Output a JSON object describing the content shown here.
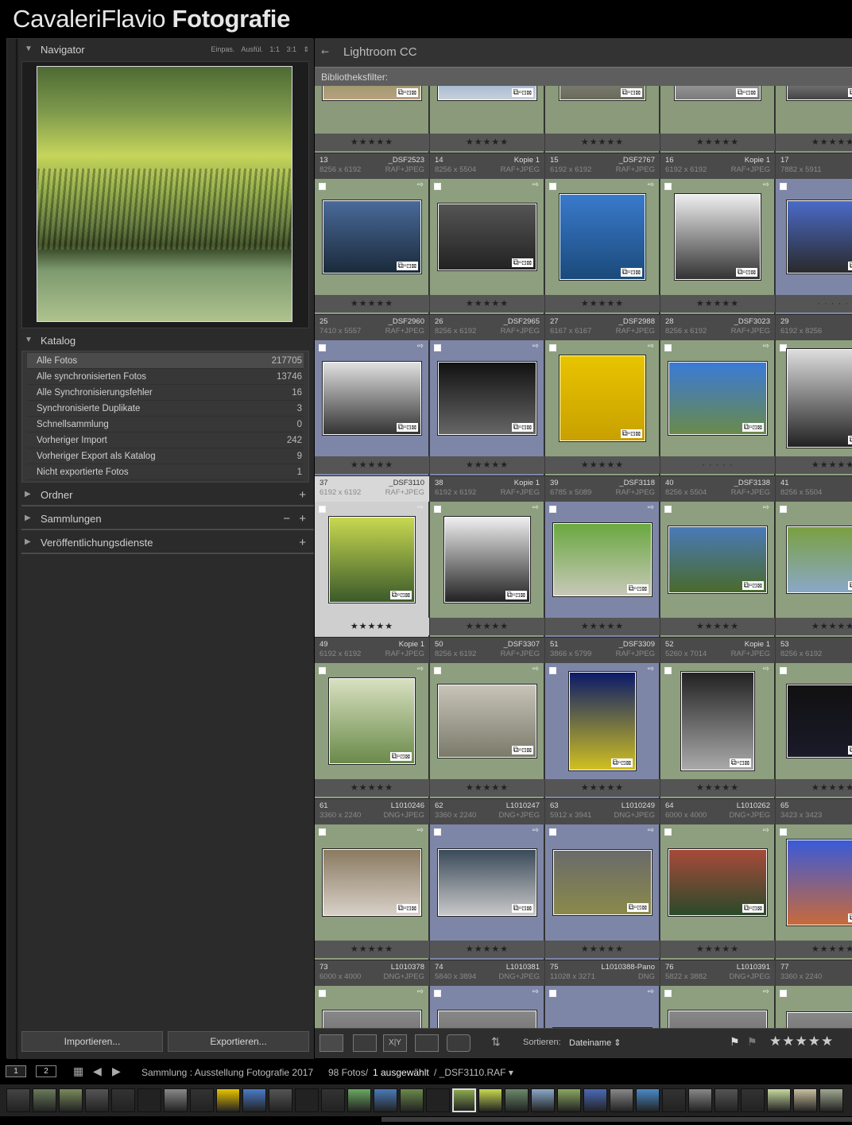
{
  "brand": {
    "first": "CavaleriFlavio ",
    "bold": "Fotografie"
  },
  "navigator": {
    "title": "Navigator",
    "options": "Einpas.  Ausfül.  1:1  3:1  ⇕"
  },
  "katalog": {
    "title": "Katalog",
    "items": [
      {
        "label": "Alle Fotos",
        "count": "217705",
        "selected": true
      },
      {
        "label": "Alle synchronisierten Fotos",
        "count": "13746"
      },
      {
        "label": "Alle Synchronisierungsfehler",
        "count": "16"
      },
      {
        "label": "Synchronisierte Duplikate",
        "count": "3"
      },
      {
        "label": "Schnellsammlung",
        "count": "0"
      },
      {
        "label": "Vorheriger Import",
        "count": "242"
      },
      {
        "label": "Vorheriger Export als Katalog",
        "count": "9"
      },
      {
        "label": "Nicht exportierte Fotos",
        "count": "1"
      }
    ]
  },
  "panels": {
    "ordner": "Ordner",
    "sammlungen": "Sammlungen",
    "veroeffentlichung": "Veröffentlichungsdienste"
  },
  "buttons": {
    "import": "Importieren...",
    "export": "Exportieren..."
  },
  "header": {
    "title": "Lightroom CC",
    "filter": "Bibliotheksfilter:"
  },
  "toolbar": {
    "sort_label": "Sortieren:",
    "sort_value": "Dateiname ⇕",
    "stars": "★★★★★"
  },
  "bottom": {
    "page1": "1",
    "page2": "2",
    "path": "Sammlung : Ausstellung Fotografie 2017",
    "count": "98 Fotos/",
    "selected": "1 ausgewählt",
    "file": "/ _DSF3110.RAF ▾"
  },
  "grid": {
    "stars": "★★★★★",
    "dots": "· · · · ·",
    "rows": [
      {
        "cells": [
          {
            "num": "",
            "name": "",
            "dim": "",
            "fmt": ""
          },
          {
            "num": "",
            "name": "",
            "dim": "",
            "fmt": ""
          },
          {
            "num": "",
            "name": "",
            "dim": "",
            "fmt": ""
          },
          {
            "num": "",
            "name": "",
            "dim": "",
            "fmt": ""
          },
          {
            "num": "",
            "name": "",
            "dim": "",
            "fmt": ""
          }
        ]
      },
      {
        "cells": [
          {
            "num": "13",
            "name": "_DSF2523",
            "dim": "8256 x 6192",
            "fmt": "RAF+JPEG"
          },
          {
            "num": "14",
            "name": "Kopie 1",
            "dim": "8256 x 5504",
            "fmt": "RAF+JPEG"
          },
          {
            "num": "15",
            "name": "_DSF2767",
            "dim": "6192 x 6192",
            "fmt": "RAF+JPEG"
          },
          {
            "num": "16",
            "name": "Kopie 1",
            "dim": "6192 x 6192",
            "fmt": "RAF+JPEG"
          },
          {
            "num": "17",
            "name": "",
            "dim": "7882 x 5911",
            "fmt": ""
          }
        ]
      },
      {
        "cells": [
          {
            "num": "25",
            "name": "_DSF2960",
            "dim": "7410 x 5557",
            "fmt": "RAF+JPEG"
          },
          {
            "num": "26",
            "name": "_DSF2965",
            "dim": "8256 x 6192",
            "fmt": "RAF+JPEG"
          },
          {
            "num": "27",
            "name": "_DSF2988",
            "dim": "6167 x 6167",
            "fmt": "RAF+JPEG"
          },
          {
            "num": "28",
            "name": "_DSF3023",
            "dim": "8256 x 6192",
            "fmt": "RAF+JPEG"
          },
          {
            "num": "29",
            "name": "",
            "dim": "6192 x 8256",
            "fmt": ""
          }
        ]
      },
      {
        "cells": [
          {
            "num": "37",
            "name": "_DSF3110",
            "dim": "6192 x 6192",
            "fmt": "RAF+JPEG"
          },
          {
            "num": "38",
            "name": "Kopie 1",
            "dim": "6192 x 6192",
            "fmt": "RAF+JPEG"
          },
          {
            "num": "39",
            "name": "_DSF3118",
            "dim": "6785 x 5089",
            "fmt": "RAF+JPEG"
          },
          {
            "num": "40",
            "name": "_DSF3138",
            "dim": "8256 x 5504",
            "fmt": "RAF+JPEG"
          },
          {
            "num": "41",
            "name": "",
            "dim": "8256 x 5504",
            "fmt": ""
          }
        ]
      },
      {
        "cells": [
          {
            "num": "49",
            "name": "Kopie 1",
            "dim": "6192 x 6192",
            "fmt": "RAF+JPEG"
          },
          {
            "num": "50",
            "name": "_DSF3307",
            "dim": "8256 x 6192",
            "fmt": "RAF+JPEG"
          },
          {
            "num": "51",
            "name": "_DSF3309",
            "dim": "3866 x 5799",
            "fmt": "RAF+JPEG"
          },
          {
            "num": "52",
            "name": "Kopie 1",
            "dim": "5260 x 7014",
            "fmt": "RAF+JPEG"
          },
          {
            "num": "53",
            "name": "",
            "dim": "8256 x 6192",
            "fmt": ""
          }
        ]
      },
      {
        "cells": [
          {
            "num": "61",
            "name": "L1010246",
            "dim": "3360 x 2240",
            "fmt": "DNG+JPEG"
          },
          {
            "num": "62",
            "name": "L1010247",
            "dim": "3360 x 2240",
            "fmt": "DNG+JPEG"
          },
          {
            "num": "63",
            "name": "L1010249",
            "dim": "5912 x 3941",
            "fmt": "DNG+JPEG"
          },
          {
            "num": "64",
            "name": "L1010262",
            "dim": "6000 x 4000",
            "fmt": "DNG+JPEG"
          },
          {
            "num": "65",
            "name": "",
            "dim": "3423 x 3423",
            "fmt": ""
          }
        ]
      },
      {
        "cells": [
          {
            "num": "73",
            "name": "L1010378",
            "dim": "6000 x 4000",
            "fmt": "DNG+JPEG"
          },
          {
            "num": "74",
            "name": "L1010381",
            "dim": "5840 x 3894",
            "fmt": "DNG+JPEG"
          },
          {
            "num": "75",
            "name": "L1010388-Pano",
            "dim": "11028 x 3271",
            "fmt": "DNG"
          },
          {
            "num": "76",
            "name": "L1010391",
            "dim": "5822 x 3882",
            "fmt": "DNG+JPEG"
          },
          {
            "num": "77",
            "name": "",
            "dim": "3360 x 2240",
            "fmt": ""
          }
        ]
      }
    ]
  }
}
